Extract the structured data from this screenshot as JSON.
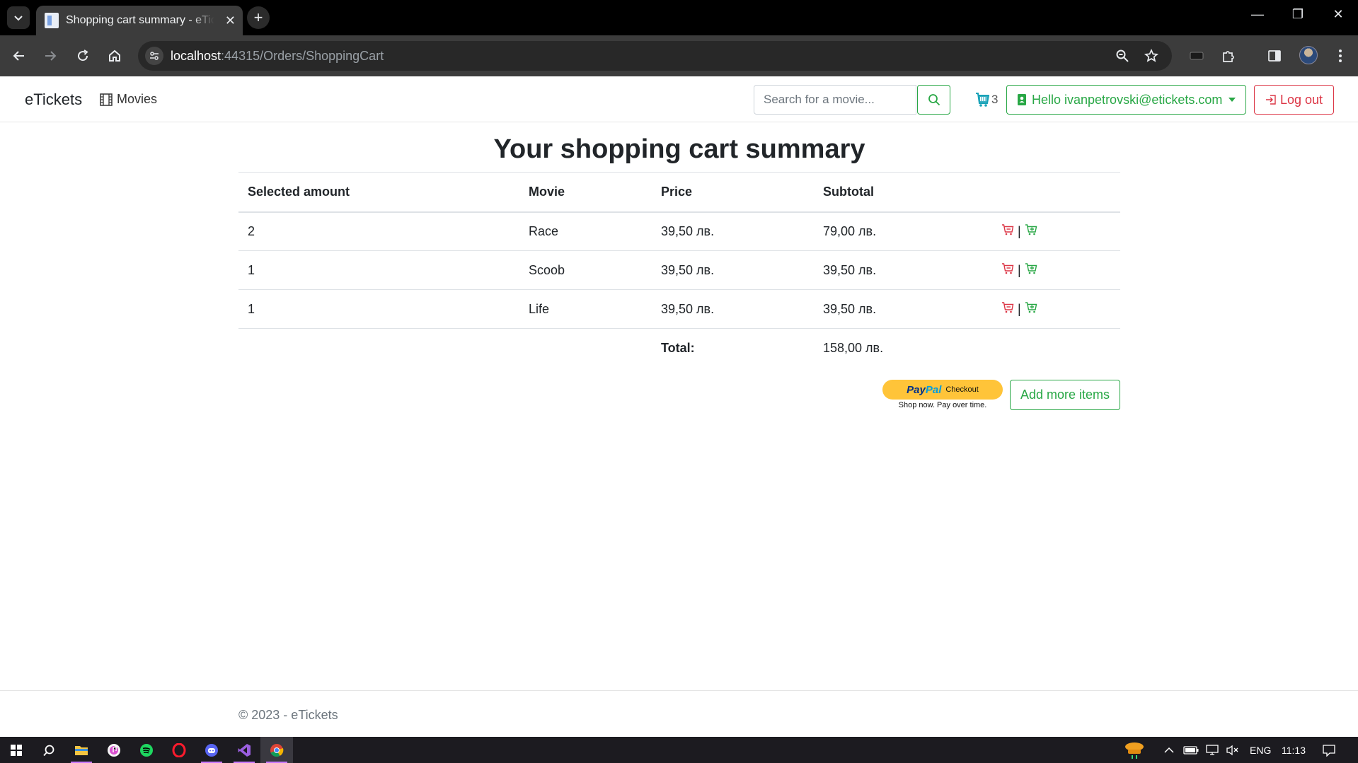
{
  "browser": {
    "tab_title": "Shopping cart summary - eTickets",
    "url_host": "localhost",
    "url_path": ":44315/Orders/ShoppingCart"
  },
  "site": {
    "brand": "eTickets",
    "nav_movies": "Movies",
    "search_placeholder": "Search for a movie...",
    "cart_count": "3",
    "user_greeting": "Hello ivanpetrovski@etickets.com",
    "logout_label": "Log out"
  },
  "cart": {
    "title": "Your shopping cart summary",
    "headers": [
      "Selected amount",
      "Movie",
      "Price",
      "Subtotal"
    ],
    "rows": [
      {
        "amount": "2",
        "movie": "Race",
        "price": "39,50 лв.",
        "subtotal": "79,00 лв."
      },
      {
        "amount": "1",
        "movie": "Scoob",
        "price": "39,50 лв.",
        "subtotal": "39,50 лв."
      },
      {
        "amount": "1",
        "movie": "Life",
        "price": "39,50 лв.",
        "subtotal": "39,50 лв."
      }
    ],
    "total_label": "Total:",
    "total_value": "158,00 лв.",
    "row_separator": "|",
    "paypal": {
      "logo_pay": "Pay",
      "logo_pal": "Pal",
      "checkout": "Checkout",
      "tagline": "Shop now. Pay over time."
    },
    "add_more_label": "Add more items"
  },
  "footer": {
    "text": "© 2023 - eTickets"
  },
  "taskbar": {
    "language": "ENG",
    "time": "11:13"
  },
  "colors": {
    "success": "#28a745",
    "danger": "#dc3545",
    "paypal_yellow": "#ffc439"
  }
}
